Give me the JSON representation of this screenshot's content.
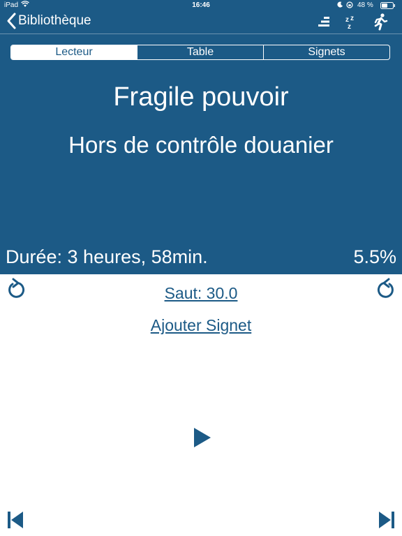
{
  "status_bar": {
    "device": "iPad",
    "time": "16:46",
    "battery": "48 %"
  },
  "nav": {
    "back_label": "Bibliothèque"
  },
  "segments": [
    {
      "label": "Lecteur",
      "active": true
    },
    {
      "label": "Table",
      "active": false
    },
    {
      "label": "Signets",
      "active": false
    }
  ],
  "player": {
    "book_title": "Fragile pouvoir",
    "chapter_title": "Hors de contrôle douanier",
    "duration": "Durée: 3 heures, 58min.",
    "progress": "5.5%",
    "skip_label": "Saut: 30.0",
    "add_bookmark_label": "Ajouter Signet"
  },
  "colors": {
    "brand_blue": "#1c5a86",
    "text_light": "#ffffff"
  }
}
